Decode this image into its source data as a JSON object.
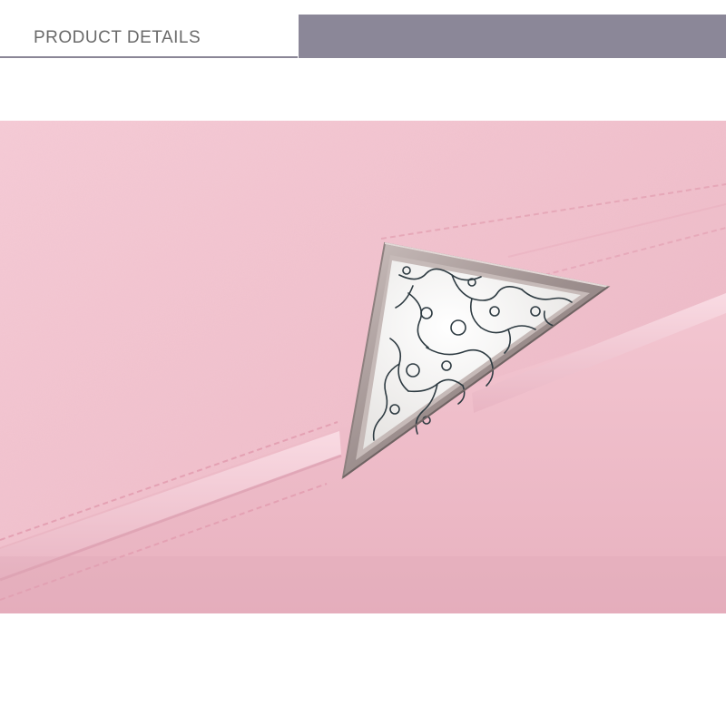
{
  "header": {
    "title": "PRODUCT DETAILS",
    "accent_color": "#8b8798",
    "title_color": "#6a6a6a"
  },
  "photo": {
    "subject": "pink-leather-wallet-closeup",
    "colors": {
      "leather": "#f2c4d0",
      "flap_edge": "#f6d2dc",
      "stitching": "#e7a6b8",
      "metal_frame": "#a79a98",
      "stone": "#f3f1ee",
      "veins": "#2c3a40"
    }
  }
}
